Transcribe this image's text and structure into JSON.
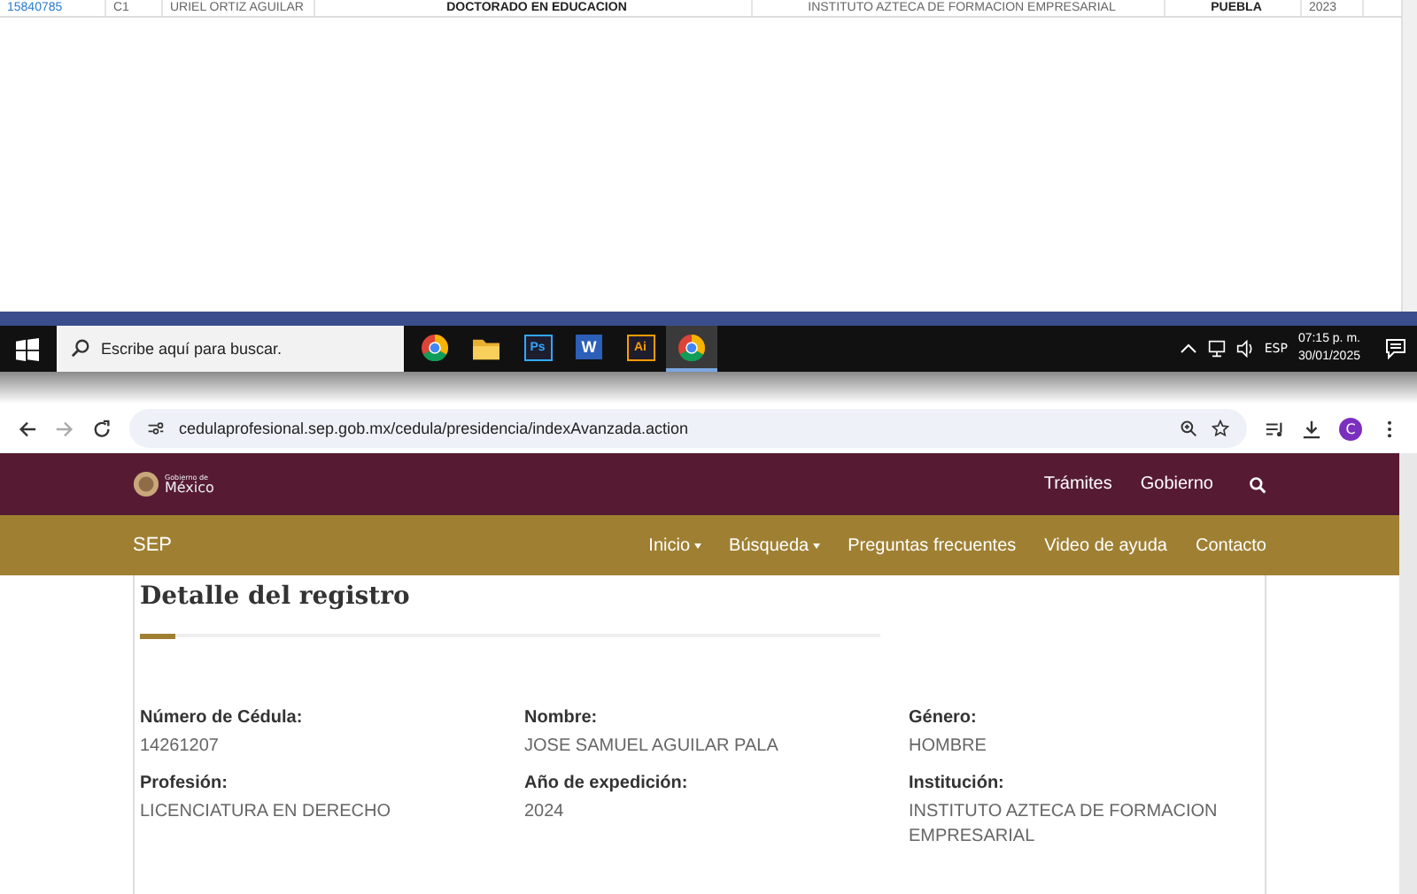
{
  "results_row": {
    "cells": [
      {
        "text": "15840785",
        "kind": "link"
      },
      {
        "text": "C1",
        "kind": "plain"
      },
      {
        "text": "URIEL ORTIZ AGUILAR",
        "kind": "plain"
      },
      {
        "text": "DOCTORADO EN EDUCACION",
        "kind": "bold"
      },
      {
        "text": "INSTITUTO AZTECA DE FORMACION EMPRESARIAL",
        "kind": "plain"
      },
      {
        "text": "PUEBLA",
        "kind": "bold"
      },
      {
        "text": "2023",
        "kind": "plain"
      }
    ]
  },
  "taskbar": {
    "search": {
      "placeholder": "Escribe aquí para buscar."
    },
    "apps": [
      {
        "kind": "chrome",
        "selected": false
      },
      {
        "kind": "folder",
        "selected": false
      },
      {
        "kind": "tile",
        "label": "Ps",
        "color": "#31a8ff",
        "selected": false
      },
      {
        "kind": "word",
        "label": "W",
        "color": "#2b5fb8",
        "selected": false
      },
      {
        "kind": "tile",
        "label": "Ai",
        "color": "#ff9a00",
        "selected": false
      },
      {
        "kind": "chrome",
        "selected": true
      }
    ],
    "language": "ESP",
    "time": "07:15 p. m.",
    "date": "30/01/2025"
  },
  "browser": {
    "url": "cedulaprofesional.sep.gob.mx/cedula/presidencia/indexAvanzada.action",
    "profile": "C"
  },
  "header": {
    "logo_small": "Gobierno de",
    "logo": "México",
    "links": [
      "Trámites",
      "Gobierno"
    ]
  },
  "nav": {
    "brand": "SEP",
    "items": [
      {
        "label": "Inicio",
        "dropdown": true
      },
      {
        "label": "Búsqueda",
        "dropdown": true
      },
      {
        "label": "Preguntas frecuentes",
        "dropdown": false
      },
      {
        "label": "Video de ayuda",
        "dropdown": false
      },
      {
        "label": "Contacto",
        "dropdown": false
      }
    ]
  },
  "detail": {
    "title": "Detalle del registro",
    "fields": [
      {
        "label": "Número de Cédula:",
        "value": "14261207"
      },
      {
        "label": "Nombre:",
        "value": "JOSE SAMUEL AGUILAR PALA"
      },
      {
        "label": "Género:",
        "value": "HOMBRE"
      },
      {
        "label": "Profesión:",
        "value": "LICENCIATURA EN DERECHO"
      },
      {
        "label": "Año de expedición:",
        "value": "2024"
      },
      {
        "label": "Institución:",
        "value": "INSTITUTO AZTECA DE FORMACION EMPRESARIAL"
      }
    ]
  }
}
